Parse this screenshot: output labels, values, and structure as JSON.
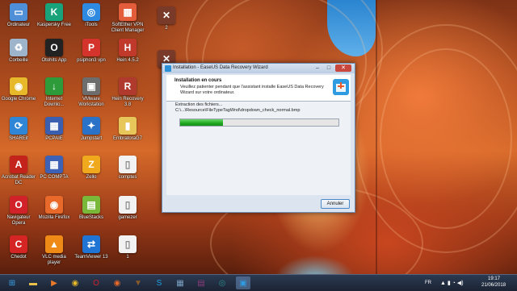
{
  "desktop_icons": [
    {
      "label": "Ordinateur",
      "icon": "computer-icon",
      "color": "#4f8fd8",
      "glyph": "▭"
    },
    {
      "label": "Kaspersky Free",
      "icon": "kaspersky-icon",
      "color": "#19a37a",
      "glyph": "K"
    },
    {
      "label": "iTools",
      "icon": "itools-icon",
      "color": "#2e8ae0",
      "glyph": "◎"
    },
    {
      "label": "SoftEther VPN Client Manager",
      "icon": "vpn-icon",
      "color": "#e45d3a",
      "glyph": "▦"
    },
    {
      "label": "Corbeille",
      "icon": "recycle-bin-icon",
      "color": "#9db4cb",
      "glyph": "♻"
    },
    {
      "label": "Otohits App",
      "icon": "otohits-icon",
      "color": "#222222",
      "glyph": "O"
    },
    {
      "label": "psiphon3 vpn",
      "icon": "psiphon-icon",
      "color": "#d4342c",
      "glyph": "P"
    },
    {
      "label": "Hein 4.5.2",
      "icon": "hein-icon",
      "color": "#c0392b",
      "glyph": "H"
    },
    {
      "label": "Google Chrome",
      "icon": "chrome-icon",
      "color": "#e6b82a",
      "glyph": "◉"
    },
    {
      "label": "Internet Downlo...",
      "icon": "idm-icon",
      "color": "#2d9b3a",
      "glyph": "↓"
    },
    {
      "label": "VMware Workstation",
      "icon": "vmware-icon",
      "color": "#6d6d6d",
      "glyph": "▣"
    },
    {
      "label": "Hein Recovery 3.8",
      "icon": "hein-recovery-icon",
      "color": "#b03a2e",
      "glyph": "R"
    },
    {
      "label": "SHAREit",
      "icon": "shareit-icon",
      "color": "#2f86d6",
      "glyph": "⟳"
    },
    {
      "label": "PCPAIE",
      "icon": "pcpaie-icon",
      "color": "#3a5fb0",
      "glyph": "▦"
    },
    {
      "label": "Jumpstart",
      "icon": "jumpstart-icon",
      "color": "#2a72c7",
      "glyph": "✦"
    },
    {
      "label": "EmbratoraG7",
      "icon": "folder-icon",
      "color": "#e8c75a",
      "glyph": "▮"
    },
    {
      "label": "Acrobat Reader DC",
      "icon": "acrobat-icon",
      "color": "#c4231c",
      "glyph": "A"
    },
    {
      "label": "PC COMPTA",
      "icon": "pccompta-icon",
      "color": "#3d62b5",
      "glyph": "▦"
    },
    {
      "label": "Zello",
      "icon": "zello-icon",
      "color": "#f0a81c",
      "glyph": "Z"
    },
    {
      "label": "comptes",
      "icon": "document-icon",
      "color": "#f2f2f2",
      "glyph": "▯"
    },
    {
      "label": "Navigateur Opera",
      "icon": "opera-icon",
      "color": "#d1222a",
      "glyph": "O"
    },
    {
      "label": "Mozilla Firefox",
      "icon": "firefox-icon",
      "color": "#e8692a",
      "glyph": "◉"
    },
    {
      "label": "BlueStacks",
      "icon": "bluestacks-icon",
      "color": "#7ab83a",
      "glyph": "▤"
    },
    {
      "label": "gamezer",
      "icon": "document-icon",
      "color": "#f2f2f2",
      "glyph": "▯"
    },
    {
      "label": "Chedot",
      "icon": "chedot-icon",
      "color": "#d52424",
      "glyph": "C"
    },
    {
      "label": "VLC media player",
      "icon": "vlc-icon",
      "color": "#f08a16",
      "glyph": "▲"
    },
    {
      "label": "TeamViewer 13",
      "icon": "teamviewer-icon",
      "color": "#1f74d4",
      "glyph": "⇄"
    },
    {
      "label": "1",
      "icon": "document-icon",
      "color": "#f2f2f2",
      "glyph": "▯"
    }
  ],
  "extra_icons": [
    {
      "label": "2",
      "icon": "shortcut-icon",
      "color": "#7a3a2a",
      "glyph": "✕"
    },
    {
      "label": "",
      "icon": "shortcut-icon",
      "color": "#7a3a2a",
      "glyph": "✕"
    }
  ],
  "dialog": {
    "title": "Installation - EaseUS Data Recovery Wizard",
    "header_title": "Installation en cours",
    "header_sub": "Veuillez patienter pendant que l'assistant installe EaseUS Data Recovery Wizard sur votre ordinateur.",
    "extract_label": "Extraction des fichiers...",
    "extract_path": "C:\\...\\Resource\\FileTypeTagWnd\\dropdown_check_normal.bmp",
    "progress_fraction": 0.27,
    "cancel_label": "Annuler"
  },
  "taskbar": {
    "apps": [
      {
        "icon": "start-icon",
        "color": "#3aa0e8",
        "glyph": "⊞"
      },
      {
        "icon": "explorer-icon",
        "color": "#e8c04a",
        "glyph": "▬"
      },
      {
        "icon": "media-player-icon",
        "color": "#e87a2a",
        "glyph": "▶"
      },
      {
        "icon": "chrome-icon",
        "color": "#e6b82a",
        "glyph": "◉"
      },
      {
        "icon": "opera-icon",
        "color": "#d1222a",
        "glyph": "O"
      },
      {
        "icon": "firefox-icon",
        "color": "#e8692a",
        "glyph": "◉"
      },
      {
        "icon": "torrent-icon",
        "color": "#8a5a2a",
        "glyph": "▼"
      },
      {
        "icon": "skype-icon",
        "color": "#1fa0e0",
        "glyph": "S"
      },
      {
        "icon": "tools-icon",
        "color": "#7aa0c0",
        "glyph": "▦"
      },
      {
        "icon": "archive-icon",
        "color": "#8a3a7a",
        "glyph": "▤"
      },
      {
        "icon": "network-icon",
        "color": "#2a8a8a",
        "glyph": "◎"
      },
      {
        "icon": "easeus-installer-icon",
        "color": "#2f9be0",
        "glyph": "▣"
      }
    ],
    "language": "FR",
    "time": "19:17",
    "date": "21/06/2018"
  }
}
